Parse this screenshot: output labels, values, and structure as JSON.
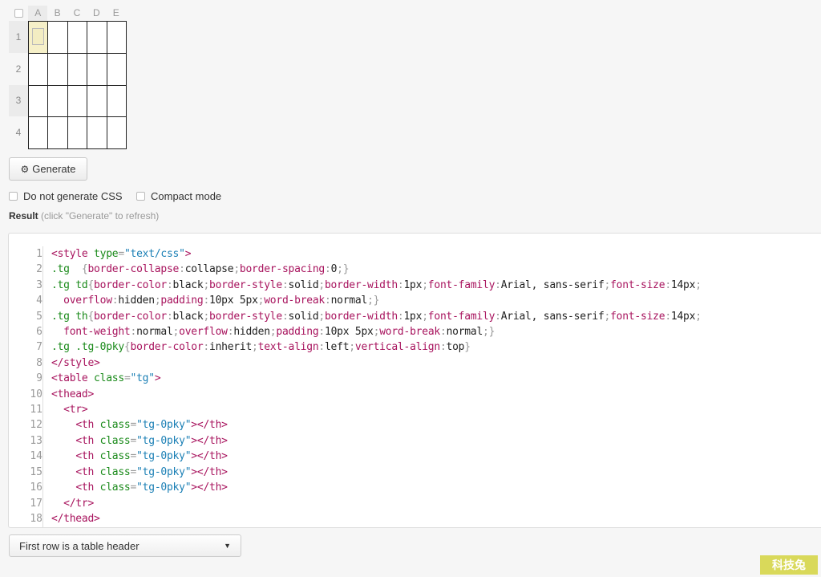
{
  "grid": {
    "columns": [
      "A",
      "B",
      "C",
      "D",
      "E"
    ],
    "rows": [
      "1",
      "2",
      "3",
      "4"
    ],
    "selected_cell": "A1"
  },
  "generate_button": {
    "label": "Generate",
    "icon": "gears-icon"
  },
  "options": [
    {
      "label": "Do not generate CSS",
      "checked": false
    },
    {
      "label": "Compact mode",
      "checked": false
    }
  ],
  "result": {
    "label": "Result",
    "hint": "(click \"Generate\" to refresh)"
  },
  "code": {
    "lines": [
      [
        [
          "t",
          "<style"
        ],
        [
          "v",
          " "
        ],
        [
          "a",
          "type"
        ],
        [
          "u",
          "="
        ],
        [
          "s",
          "\"text/css\""
        ],
        [
          "t",
          ">"
        ]
      ],
      [
        [
          "sel",
          ".tg"
        ],
        [
          "u",
          "  {"
        ],
        [
          "p",
          "border-collapse"
        ],
        [
          "u",
          ":"
        ],
        [
          "v",
          "collapse"
        ],
        [
          "u",
          ";"
        ],
        [
          "p",
          "border-spacing"
        ],
        [
          "u",
          ":"
        ],
        [
          "v",
          "0"
        ],
        [
          "u",
          ";}"
        ]
      ],
      [
        [
          "sel",
          ".tg td"
        ],
        [
          "u",
          "{"
        ],
        [
          "p",
          "border-color"
        ],
        [
          "u",
          ":"
        ],
        [
          "v",
          "black"
        ],
        [
          "u",
          ";"
        ],
        [
          "p",
          "border-style"
        ],
        [
          "u",
          ":"
        ],
        [
          "v",
          "solid"
        ],
        [
          "u",
          ";"
        ],
        [
          "p",
          "border-width"
        ],
        [
          "u",
          ":"
        ],
        [
          "v",
          "1px"
        ],
        [
          "u",
          ";"
        ],
        [
          "p",
          "font-family"
        ],
        [
          "u",
          ":"
        ],
        [
          "v",
          "Arial, sans-serif"
        ],
        [
          "u",
          ";"
        ],
        [
          "p",
          "font-size"
        ],
        [
          "u",
          ":"
        ],
        [
          "v",
          "14px"
        ],
        [
          "u",
          ";"
        ]
      ],
      [
        [
          "v",
          "  "
        ],
        [
          "p",
          "overflow"
        ],
        [
          "u",
          ":"
        ],
        [
          "v",
          "hidden"
        ],
        [
          "u",
          ";"
        ],
        [
          "p",
          "padding"
        ],
        [
          "u",
          ":"
        ],
        [
          "v",
          "10px 5px"
        ],
        [
          "u",
          ";"
        ],
        [
          "p",
          "word-break"
        ],
        [
          "u",
          ":"
        ],
        [
          "v",
          "normal"
        ],
        [
          "u",
          ";}"
        ]
      ],
      [
        [
          "sel",
          ".tg th"
        ],
        [
          "u",
          "{"
        ],
        [
          "p",
          "border-color"
        ],
        [
          "u",
          ":"
        ],
        [
          "v",
          "black"
        ],
        [
          "u",
          ";"
        ],
        [
          "p",
          "border-style"
        ],
        [
          "u",
          ":"
        ],
        [
          "v",
          "solid"
        ],
        [
          "u",
          ";"
        ],
        [
          "p",
          "border-width"
        ],
        [
          "u",
          ":"
        ],
        [
          "v",
          "1px"
        ],
        [
          "u",
          ";"
        ],
        [
          "p",
          "font-family"
        ],
        [
          "u",
          ":"
        ],
        [
          "v",
          "Arial, sans-serif"
        ],
        [
          "u",
          ";"
        ],
        [
          "p",
          "font-size"
        ],
        [
          "u",
          ":"
        ],
        [
          "v",
          "14px"
        ],
        [
          "u",
          ";"
        ]
      ],
      [
        [
          "v",
          "  "
        ],
        [
          "p",
          "font-weight"
        ],
        [
          "u",
          ":"
        ],
        [
          "v",
          "normal"
        ],
        [
          "u",
          ";"
        ],
        [
          "p",
          "overflow"
        ],
        [
          "u",
          ":"
        ],
        [
          "v",
          "hidden"
        ],
        [
          "u",
          ";"
        ],
        [
          "p",
          "padding"
        ],
        [
          "u",
          ":"
        ],
        [
          "v",
          "10px 5px"
        ],
        [
          "u",
          ";"
        ],
        [
          "p",
          "word-break"
        ],
        [
          "u",
          ":"
        ],
        [
          "v",
          "normal"
        ],
        [
          "u",
          ";}"
        ]
      ],
      [
        [
          "sel",
          ".tg .tg-0pky"
        ],
        [
          "u",
          "{"
        ],
        [
          "p",
          "border-color"
        ],
        [
          "u",
          ":"
        ],
        [
          "v",
          "inherit"
        ],
        [
          "u",
          ";"
        ],
        [
          "p",
          "text-align"
        ],
        [
          "u",
          ":"
        ],
        [
          "v",
          "left"
        ],
        [
          "u",
          ";"
        ],
        [
          "p",
          "vertical-align"
        ],
        [
          "u",
          ":"
        ],
        [
          "v",
          "top"
        ],
        [
          "u",
          "}"
        ]
      ],
      [
        [
          "t",
          "</style>"
        ]
      ],
      [
        [
          "t",
          "<table"
        ],
        [
          "v",
          " "
        ],
        [
          "a",
          "class"
        ],
        [
          "u",
          "="
        ],
        [
          "s",
          "\"tg\""
        ],
        [
          "t",
          ">"
        ]
      ],
      [
        [
          "t",
          "<thead>"
        ]
      ],
      [
        [
          "v",
          "  "
        ],
        [
          "t",
          "<tr>"
        ]
      ],
      [
        [
          "v",
          "    "
        ],
        [
          "t",
          "<th"
        ],
        [
          "v",
          " "
        ],
        [
          "a",
          "class"
        ],
        [
          "u",
          "="
        ],
        [
          "s",
          "\"tg-0pky\""
        ],
        [
          "t",
          "></th>"
        ]
      ],
      [
        [
          "v",
          "    "
        ],
        [
          "t",
          "<th"
        ],
        [
          "v",
          " "
        ],
        [
          "a",
          "class"
        ],
        [
          "u",
          "="
        ],
        [
          "s",
          "\"tg-0pky\""
        ],
        [
          "t",
          "></th>"
        ]
      ],
      [
        [
          "v",
          "    "
        ],
        [
          "t",
          "<th"
        ],
        [
          "v",
          " "
        ],
        [
          "a",
          "class"
        ],
        [
          "u",
          "="
        ],
        [
          "s",
          "\"tg-0pky\""
        ],
        [
          "t",
          "></th>"
        ]
      ],
      [
        [
          "v",
          "    "
        ],
        [
          "t",
          "<th"
        ],
        [
          "v",
          " "
        ],
        [
          "a",
          "class"
        ],
        [
          "u",
          "="
        ],
        [
          "s",
          "\"tg-0pky\""
        ],
        [
          "t",
          "></th>"
        ]
      ],
      [
        [
          "v",
          "    "
        ],
        [
          "t",
          "<th"
        ],
        [
          "v",
          " "
        ],
        [
          "a",
          "class"
        ],
        [
          "u",
          "="
        ],
        [
          "s",
          "\"tg-0pky\""
        ],
        [
          "t",
          "></th>"
        ]
      ],
      [
        [
          "v",
          "  "
        ],
        [
          "t",
          "</tr>"
        ]
      ],
      [
        [
          "t",
          "</thead>"
        ]
      ]
    ]
  },
  "header_dropdown": {
    "selected": "First row is a table header"
  },
  "watermark": "科技兔"
}
